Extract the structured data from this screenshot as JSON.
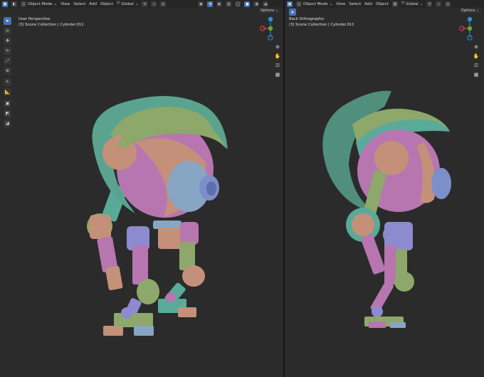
{
  "header": {
    "mode_label": "Object Mode",
    "menus": [
      "View",
      "Select",
      "Add",
      "Object"
    ],
    "orientation_label": "Global",
    "options_label": "Options"
  },
  "viewports": {
    "left": {
      "view_name": "User Perspective",
      "collection": "(3) Scene Collection | Cylinder.011"
    },
    "right": {
      "view_name": "Back Orthographic",
      "collection": "(3) Scene Collection | Cylinder.011"
    }
  },
  "gizmo": {
    "axes": [
      "X",
      "Y",
      "Z"
    ]
  },
  "icons": {
    "toolbar": [
      "select-box-icon",
      "cursor-icon",
      "move-icon",
      "rotate-icon",
      "scale-icon",
      "transform-icon",
      "annotate-icon",
      "measure-icon",
      "add-cube-icon"
    ],
    "navigation": [
      "zoom-icon",
      "hand-pan-icon",
      "camera-icon",
      "grid-icon"
    ]
  },
  "colors": {
    "active_tool": "#4772b3",
    "axis_x": "#e04455",
    "axis_y": "#6ca630",
    "axis_z": "#2b92d9",
    "teal": "#5aaa99",
    "pink": "#b776b0",
    "olive": "#8da86a",
    "peach": "#c5907a",
    "lavender": "#8d8bcf",
    "blue": "#86a6c4"
  }
}
